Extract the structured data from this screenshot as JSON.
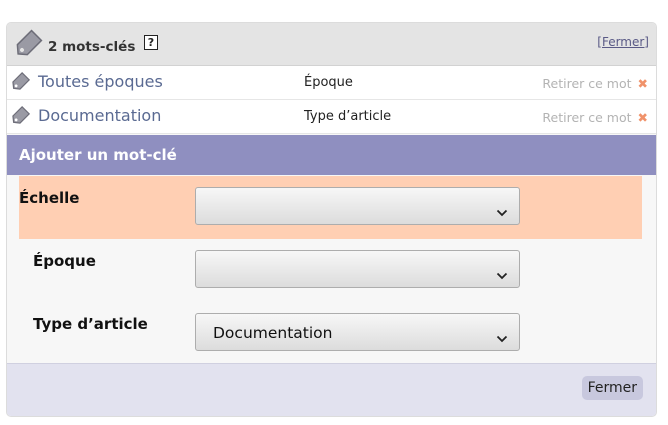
{
  "header": {
    "count_label": "2 mots-clés",
    "help_label": "?",
    "close_label": "[Fermer]"
  },
  "keywords": [
    {
      "name": "Toutes époques",
      "group": "Époque",
      "remove_label": "Retirer ce mot",
      "remove_icon": "✖"
    },
    {
      "name": "Documentation",
      "group": "Type d’article",
      "remove_label": "Retirer ce mot",
      "remove_icon": "✖"
    }
  ],
  "add_section": {
    "title": "Ajouter un mot-clé",
    "fields": [
      {
        "label": "Échelle",
        "value": ""
      },
      {
        "label": "Époque",
        "value": ""
      },
      {
        "label": "Type d’article",
        "value": "Documentation"
      }
    ]
  },
  "footer": {
    "close_button": "Fermer"
  },
  "colors": {
    "header_bg": "#e4e4e4",
    "accent_bar": "#8f8fc0",
    "highlight_row": "#ffcfb3",
    "remove_icon": "#f0926a",
    "keyword_link": "#5a6a92",
    "footer_bg": "#e2e2ef"
  }
}
